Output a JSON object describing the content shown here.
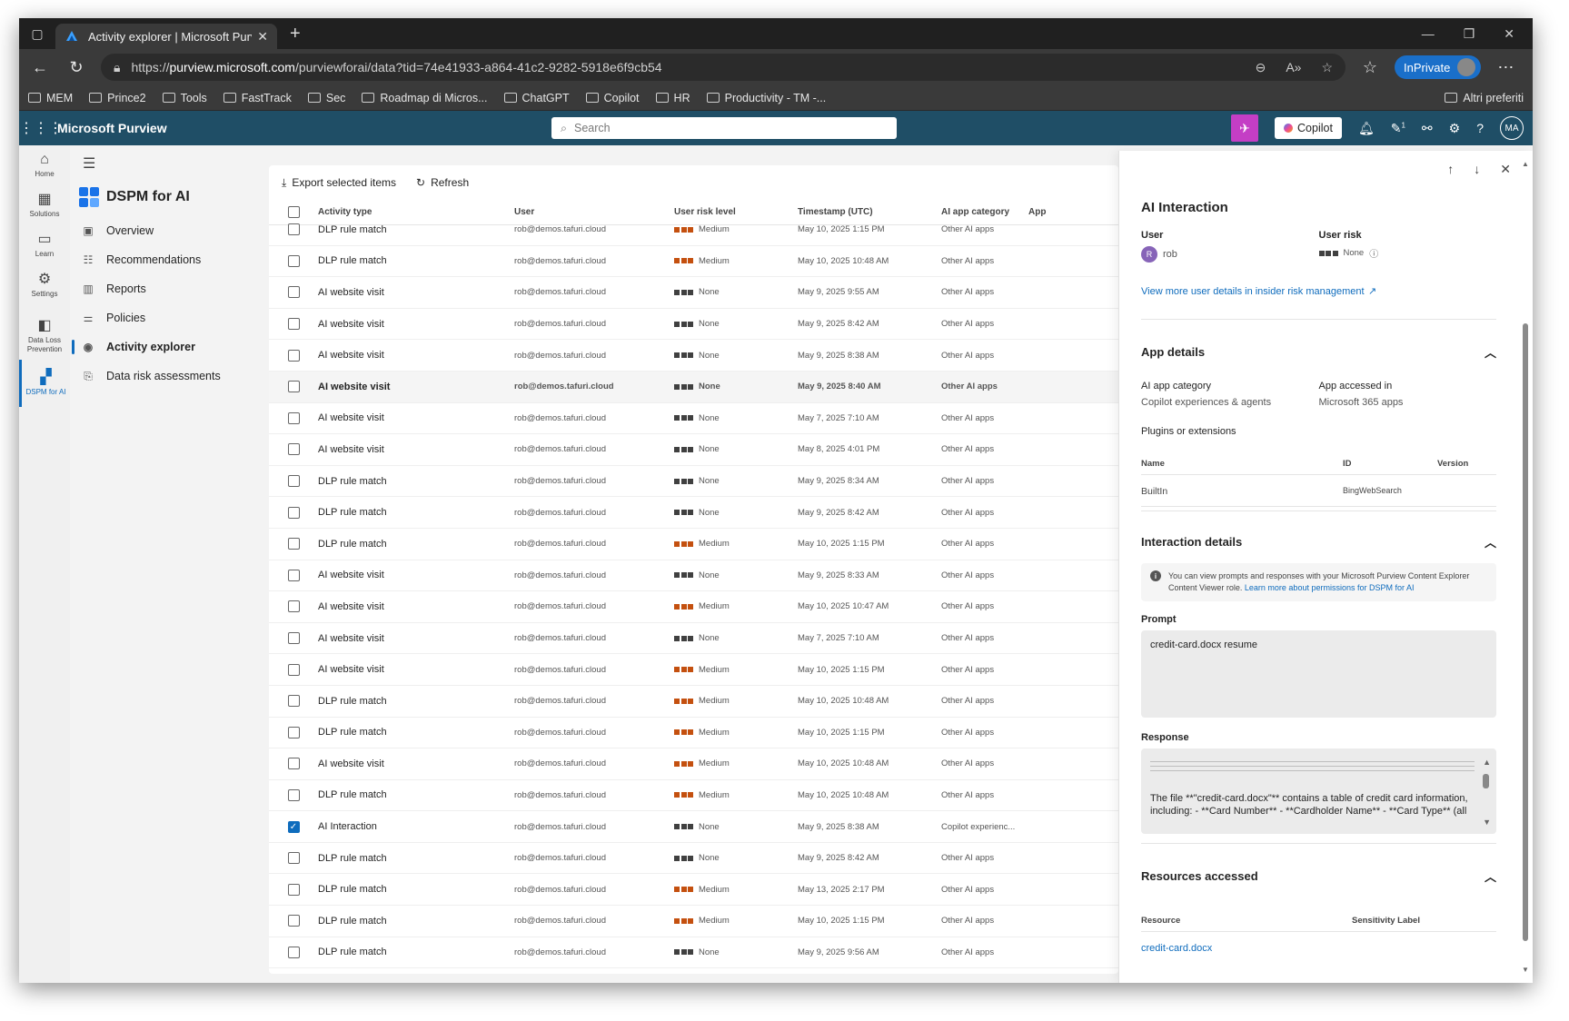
{
  "browser": {
    "tab_title": "Activity explorer | Microsoft Purview",
    "tab_close": "✕",
    "new_tab": "+",
    "url_prefix": "https://",
    "url_domain": "purview.microsoft.com",
    "url_path": "/purviewforai/data?tid=74e41933-a864-41c2-9282-5918e6f9cb54",
    "inprivate_label": "InPrivate",
    "favorites": [
      "MEM",
      "Prince2",
      "Tools",
      "FastTrack",
      "Sec",
      "Roadmap di Micros...",
      "ChatGPT",
      "Copilot",
      "HR",
      "Productivity - TM -..."
    ],
    "favorites_right": "Altri preferiti"
  },
  "header": {
    "brand": "Microsoft Purview",
    "search_placeholder": "Search",
    "copilot_label": "Copilot",
    "me_initials": "MA",
    "notification_count": "1"
  },
  "rail": [
    {
      "label": "Home",
      "icon": "home-icon"
    },
    {
      "label": "Solutions",
      "icon": "solutions-icon"
    },
    {
      "label": "Learn",
      "icon": "learn-icon"
    },
    {
      "label": "Settings",
      "icon": "gear-icon"
    },
    {
      "label": "Data Loss Prevention",
      "icon": "dlp-icon"
    },
    {
      "label": "DSPM for AI",
      "icon": "dspm-icon"
    }
  ],
  "nav": {
    "title": "DSPM for AI",
    "items": [
      {
        "label": "Overview",
        "icon": "overview-icon"
      },
      {
        "label": "Recommendations",
        "icon": "recommendations-icon"
      },
      {
        "label": "Reports",
        "icon": "reports-icon"
      },
      {
        "label": "Policies",
        "icon": "policies-icon"
      },
      {
        "label": "Activity explorer",
        "icon": "activity-icon"
      },
      {
        "label": "Data risk assessments",
        "icon": "assessment-icon"
      }
    ]
  },
  "commands": {
    "export": "Export selected items",
    "refresh": "Refresh"
  },
  "table": {
    "columns": [
      "Activity type",
      "User",
      "User risk level",
      "Timestamp (UTC)",
      "AI app category",
      "App"
    ],
    "rows": [
      {
        "activity": "DLP rule match",
        "user": "rob@demos.tafuri.cloud",
        "risk": "Medium",
        "ts": "May 10, 2025 1:15 PM",
        "cat": "Other AI apps",
        "checked": false
      },
      {
        "activity": "DLP rule match",
        "user": "rob@demos.tafuri.cloud",
        "risk": "Medium",
        "ts": "May 10, 2025 10:48 AM",
        "cat": "Other AI apps",
        "checked": false
      },
      {
        "activity": "AI website visit",
        "user": "rob@demos.tafuri.cloud",
        "risk": "None",
        "ts": "May 9, 2025 9:55 AM",
        "cat": "Other AI apps",
        "checked": false
      },
      {
        "activity": "AI website visit",
        "user": "rob@demos.tafuri.cloud",
        "risk": "None",
        "ts": "May 9, 2025 8:42 AM",
        "cat": "Other AI apps",
        "checked": false
      },
      {
        "activity": "AI website visit",
        "user": "rob@demos.tafuri.cloud",
        "risk": "None",
        "ts": "May 9, 2025 8:38 AM",
        "cat": "Other AI apps",
        "checked": false
      },
      {
        "activity": "AI website visit",
        "user": "rob@demos.tafuri.cloud",
        "risk": "None",
        "ts": "May 9, 2025 8:40 AM",
        "cat": "Other AI apps",
        "checked": false,
        "hl": true
      },
      {
        "activity": "AI website visit",
        "user": "rob@demos.tafuri.cloud",
        "risk": "None",
        "ts": "May 7, 2025 7:10 AM",
        "cat": "Other AI apps",
        "checked": false
      },
      {
        "activity": "AI website visit",
        "user": "rob@demos.tafuri.cloud",
        "risk": "None",
        "ts": "May 8, 2025 4:01 PM",
        "cat": "Other AI apps",
        "checked": false
      },
      {
        "activity": "DLP rule match",
        "user": "rob@demos.tafuri.cloud",
        "risk": "None",
        "ts": "May 9, 2025 8:34 AM",
        "cat": "Other AI apps",
        "checked": false
      },
      {
        "activity": "DLP rule match",
        "user": "rob@demos.tafuri.cloud",
        "risk": "None",
        "ts": "May 9, 2025 8:42 AM",
        "cat": "Other AI apps",
        "checked": false
      },
      {
        "activity": "DLP rule match",
        "user": "rob@demos.tafuri.cloud",
        "risk": "Medium",
        "ts": "May 10, 2025 1:15 PM",
        "cat": "Other AI apps",
        "checked": false
      },
      {
        "activity": "AI website visit",
        "user": "rob@demos.tafuri.cloud",
        "risk": "None",
        "ts": "May 9, 2025 8:33 AM",
        "cat": "Other AI apps",
        "checked": false
      },
      {
        "activity": "AI website visit",
        "user": "rob@demos.tafuri.cloud",
        "risk": "Medium",
        "ts": "May 10, 2025 10:47 AM",
        "cat": "Other AI apps",
        "checked": false
      },
      {
        "activity": "AI website visit",
        "user": "rob@demos.tafuri.cloud",
        "risk": "None",
        "ts": "May 7, 2025 7:10 AM",
        "cat": "Other AI apps",
        "checked": false
      },
      {
        "activity": "AI website visit",
        "user": "rob@demos.tafuri.cloud",
        "risk": "Medium",
        "ts": "May 10, 2025 1:15 PM",
        "cat": "Other AI apps",
        "checked": false
      },
      {
        "activity": "DLP rule match",
        "user": "rob@demos.tafuri.cloud",
        "risk": "Medium",
        "ts": "May 10, 2025 10:48 AM",
        "cat": "Other AI apps",
        "checked": false
      },
      {
        "activity": "DLP rule match",
        "user": "rob@demos.tafuri.cloud",
        "risk": "Medium",
        "ts": "May 10, 2025 1:15 PM",
        "cat": "Other AI apps",
        "checked": false
      },
      {
        "activity": "AI website visit",
        "user": "rob@demos.tafuri.cloud",
        "risk": "Medium",
        "ts": "May 10, 2025 10:48 AM",
        "cat": "Other AI apps",
        "checked": false
      },
      {
        "activity": "DLP rule match",
        "user": "rob@demos.tafuri.cloud",
        "risk": "Medium",
        "ts": "May 10, 2025 10:48 AM",
        "cat": "Other AI apps",
        "checked": false
      },
      {
        "activity": "AI Interaction",
        "user": "rob@demos.tafuri.cloud",
        "risk": "None",
        "ts": "May 9, 2025 8:38 AM",
        "cat": "Copilot experienc...",
        "checked": true
      },
      {
        "activity": "DLP rule match",
        "user": "rob@demos.tafuri.cloud",
        "risk": "None",
        "ts": "May 9, 2025 8:42 AM",
        "cat": "Other AI apps",
        "checked": false
      },
      {
        "activity": "DLP rule match",
        "user": "rob@demos.tafuri.cloud",
        "risk": "Medium",
        "ts": "May 13, 2025 2:17 PM",
        "cat": "Other AI apps",
        "checked": false
      },
      {
        "activity": "DLP rule match",
        "user": "rob@demos.tafuri.cloud",
        "risk": "Medium",
        "ts": "May 10, 2025 1:15 PM",
        "cat": "Other AI apps",
        "checked": false
      },
      {
        "activity": "DLP rule match",
        "user": "rob@demos.tafuri.cloud",
        "risk": "None",
        "ts": "May 9, 2025 9:56 AM",
        "cat": "Other AI apps",
        "checked": false
      }
    ]
  },
  "risk_colors": {
    "Medium": "#c4500f",
    "None": "#404040"
  },
  "panel": {
    "title": "AI Interaction",
    "user_label": "User",
    "user_initial": "R",
    "user_name": "rob",
    "user_risk_label": "User risk",
    "user_risk_value": "None",
    "user_details_link": "View more user details in insider risk management",
    "app_details": {
      "heading": "App details",
      "category_label": "AI app category",
      "category_value": "Copilot experiences & agents",
      "accessed_label": "App accessed in",
      "accessed_value": "Microsoft 365 apps",
      "plugins_label": "Plugins or extensions",
      "cols": [
        "Name",
        "ID",
        "Version"
      ],
      "row": {
        "name": "BuiltIn",
        "id": "BingWebSearch",
        "version": ""
      }
    },
    "interaction": {
      "heading": "Interaction details",
      "notice": "You can view prompts and responses with your Microsoft Purview Content Explorer Content Viewer role.",
      "notice_link": "Learn more about permissions for DSPM for AI",
      "prompt_label": "Prompt",
      "prompt_value": "credit-card.docx resume",
      "response_label": "Response",
      "response_value": "The file **\"credit-card.docx\"** contains a table of credit card information, including: - **Card Number** - **Cardholder Name** - **Card Type** (all"
    },
    "resources": {
      "heading": "Resources accessed",
      "cols": [
        "Resource",
        "Sensitivity Label"
      ],
      "row": {
        "resource": "credit-card.docx",
        "label": ""
      }
    }
  }
}
